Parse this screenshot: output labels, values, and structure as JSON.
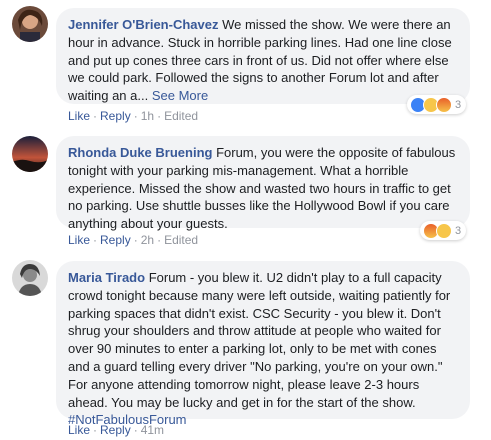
{
  "comments": [
    {
      "author": "Jennifer O'Brien-Chavez",
      "lines": [
        "We missed the show. We were there an",
        "hour in advance. Stuck in horrible parking lines. Had one line close",
        "and put up cones three cars in front of us. Did not offer where else",
        "we could park. Followed the signs to another Forum lot and after",
        "waiting an a..."
      ],
      "see_more": "See More",
      "like": "Like",
      "reply": "Reply",
      "time": "1h",
      "edited": "Edited",
      "reaction_count": "3",
      "reactions": [
        "like-icon",
        "sad-icon",
        "angry-icon"
      ]
    },
    {
      "author": "Rhonda Duke Bruening",
      "lines": [
        "Forum, you were the opposite of fabulous",
        "tonight with your parking mis-management. What a horrible",
        "experience. Missed the show and wasted two hours in traffic to get",
        "no parking. Use shuttle busses like the Hollywood Bowl if you care",
        "anything about your guests."
      ],
      "like": "Like",
      "reply": "Reply",
      "time": "2h",
      "edited": "Edited",
      "reaction_count": "3",
      "reactions": [
        "angry-icon",
        "sad-icon"
      ]
    },
    {
      "author": "Maria Tirado",
      "lines": [
        "Forum - you blew it. U2 didn't play to a full capacity",
        "crowd tonight because many were left outside, waiting patiently for",
        "parking spaces that didn't exist. CSC Security - you blew it. Don't",
        "shrug your shoulders and throw attitude at people who waited for",
        "over 90 minutes to enter a parking lot, only to be met with cones",
        "and a guard telling every driver \"No parking, you're on your own.\"",
        "For anyone attending tomorrow night, please leave 2-3 hours",
        "ahead. You may be lucky and get in for the start of the show."
      ],
      "hashtag": "#NotFabulousForum",
      "like": "Like",
      "reply": "Reply",
      "time": "41m"
    }
  ],
  "colors": {
    "link": "#385898",
    "bubble": "#f2f3f5",
    "meta": "#90949c"
  }
}
